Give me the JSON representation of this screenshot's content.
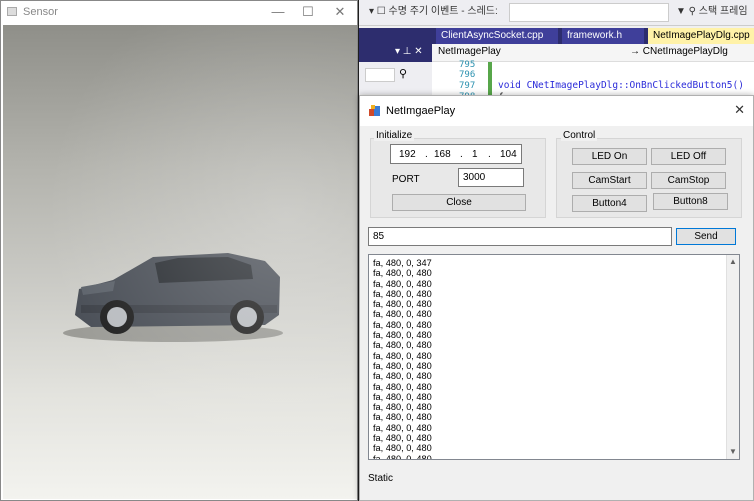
{
  "sensor": {
    "title": "Sensor",
    "min": "—",
    "max": "☐",
    "close": "✕"
  },
  "vs": {
    "combo1": "▾  ☐  수명 주기 이벤트 - 스레드:",
    "combo2": "",
    "toolbar_right": "▼  ⚲  스택 프레임",
    "tabs": [
      {
        "label": "ClientAsyncSocket.cpp"
      },
      {
        "label": "framework.h"
      },
      {
        "label": "NetImagePlayDlg.cpp  ⇥"
      }
    ],
    "side_label": "▾  ⊥  ✕",
    "nav_class": "NetImagePlay",
    "nav_member": "→ CNetImagePlayDlg",
    "line_numbers": [
      "795",
      "796",
      "797",
      "798"
    ],
    "code_line": "void CNetImagePlayDlg::OnBnClickedButton5()",
    "code_brace": "{"
  },
  "dialog": {
    "title": "NetImgaePlay",
    "close": "✕",
    "initialize_label": "Initialize",
    "ip": [
      "192",
      "168",
      "1",
      "104"
    ],
    "port_label": "PORT",
    "port_value": "3000",
    "close_button": "Close",
    "control_label": "Control",
    "buttons": {
      "led_on": "LED On",
      "led_off": "LED Off",
      "cam_start": "CamStart",
      "cam_stop": "CamStop",
      "button4": "Button4",
      "button8": "Button8"
    },
    "send_value": "85",
    "send_button": "Send",
    "log_lines": [
      "fa, 480, 0, 347",
      "fa, 480, 0, 480",
      "fa, 480, 0, 480",
      "fa, 480, 0, 480",
      "fa, 480, 0, 480",
      "fa, 480, 0, 480",
      "fa, 480, 0, 480",
      "fa, 480, 0, 480",
      "fa, 480, 0, 480",
      "fa, 480, 0, 480",
      "fa, 480, 0, 480",
      "fa, 480, 0, 480",
      "fa, 480, 0, 480",
      "fa, 480, 0, 480",
      "fa, 480, 0, 480",
      "fa, 480, 0, 480",
      "fa, 480, 0, 480",
      "fa, 480, 0, 480",
      "fa, 480, 0, 480",
      "fa, 480, 0, 480",
      "fa, 480, 0, 480"
    ],
    "status": "Static"
  }
}
